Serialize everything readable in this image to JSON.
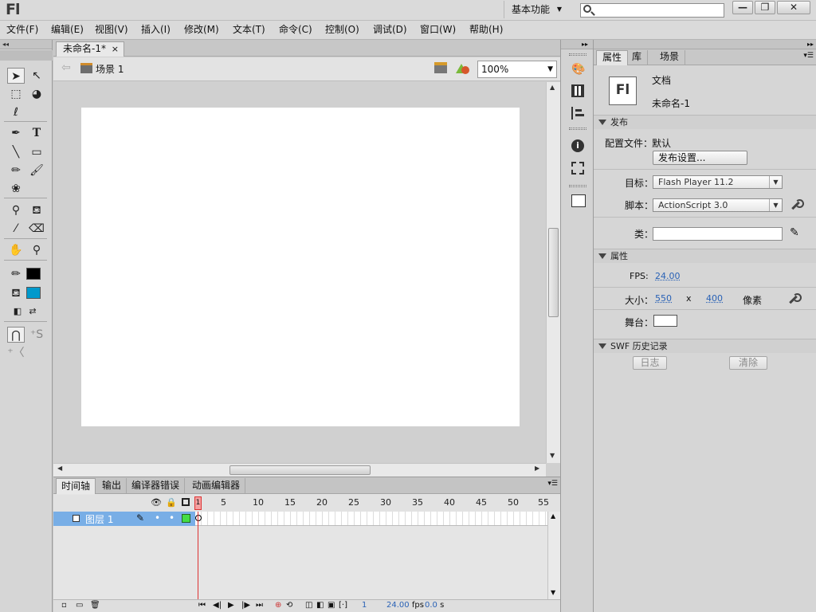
{
  "app": {
    "logo": "Fl"
  },
  "titlebar": {
    "workspace": "基本功能",
    "search_placeholder": "",
    "minimize": "—",
    "maximize": "❐",
    "close": "✕"
  },
  "menu": [
    "文件(F)",
    "编辑(E)",
    "视图(V)",
    "插入(I)",
    "修改(M)",
    "文本(T)",
    "命令(C)",
    "控制(O)",
    "调试(D)",
    "窗口(W)",
    "帮助(H)"
  ],
  "colors": {
    "stroke": "#000000",
    "fill": "#0099cc",
    "stage": "#ffffff",
    "layer_highlight": "#78aee6",
    "playhead": "#dd3333"
  },
  "document": {
    "tab_title": "未命名-1*",
    "tab_close": "×",
    "scene": "场景 1",
    "zoom": "100%"
  },
  "timeline": {
    "tabs": [
      "时间轴",
      "输出",
      "编译器错误",
      "动画编辑器"
    ],
    "ruler": [
      "1",
      "5",
      "10",
      "15",
      "20",
      "25",
      "30",
      "35",
      "40",
      "45",
      "50",
      "55"
    ],
    "playhead": "1",
    "layer": "图层 1",
    "footer": {
      "frame": "1",
      "fps": "24.00",
      "fps_unit": "fps",
      "time": "0.0",
      "time_unit": "s"
    }
  },
  "properties": {
    "tabs": [
      "属性",
      "库",
      "场景"
    ],
    "doc_icon": "Fl",
    "doc_type": "文档",
    "doc_name": "未命名-1",
    "publish": {
      "header": "发布",
      "profile_label": "配置文件：",
      "profile_value": "默认",
      "settings_button": "发布设置...",
      "target_label": "目标：",
      "target_value": "Flash Player 11.2",
      "script_label": "脚本：",
      "script_value": "ActionScript 3.0",
      "class_label": "类："
    },
    "attributes": {
      "header": "属性",
      "fps_label": "FPS:",
      "fps_value": "24.00",
      "size_label": "大小：",
      "width": "550",
      "x": "x",
      "height": "400",
      "unit": "像素",
      "stage_label": "舞台："
    },
    "swf_history": {
      "header": "SWF 历史记录",
      "log_button": "日志",
      "clear_button": "清除"
    }
  }
}
